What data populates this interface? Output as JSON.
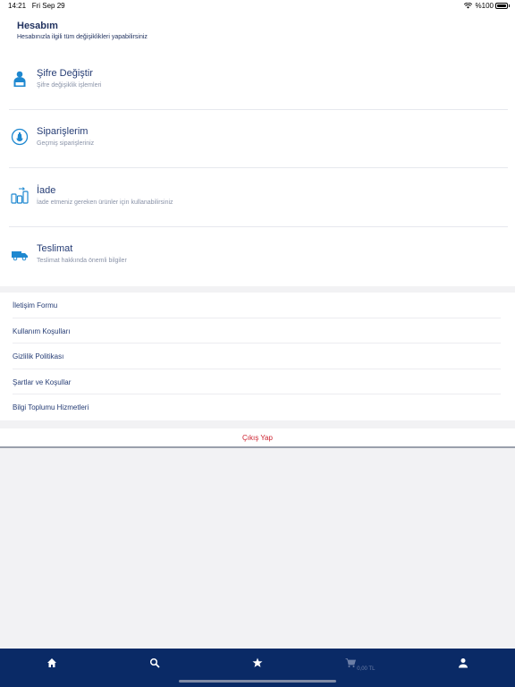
{
  "status_bar": {
    "time": "14:21",
    "date": "Fri Sep 29",
    "battery": "%100"
  },
  "header": {
    "title": "Hesabım",
    "subtitle": "Hesabınızla ilgili tüm değişiklikleri yapabilirsiniz"
  },
  "menu": [
    {
      "label": "Şifre Değiştir",
      "desc": "Şifre değişiklik işlemleri",
      "icon": "user-icon"
    },
    {
      "label": "Siparişlerim",
      "desc": "Geçmiş siparişleriniz",
      "icon": "orders-icon"
    },
    {
      "label": "İade",
      "desc": "İade etmeniz gereken ürünler için kullanabilirsiniz",
      "icon": "return-icon"
    },
    {
      "label": "Teslimat",
      "desc": "Teslimat hakkında önemli bilgiler",
      "icon": "delivery-truck-icon"
    }
  ],
  "links": [
    "İletişim Formu",
    "Kullanım Koşulları",
    "Gizlilik Politikası",
    "Şartlar ve Koşullar",
    "Bilgi Toplumu Hizmetleri"
  ],
  "logout_label": "Çıkış Yap",
  "tabbar": {
    "tabs": [
      "home-icon",
      "search-icon",
      "star-icon",
      "cart-icon",
      "profile-icon"
    ],
    "cart_total": "0,00 TL",
    "active": "profile-icon"
  },
  "colors": {
    "accent": "#0a2a66",
    "icon_blue": "#1e88d0",
    "logout_red": "#cc1f2d"
  }
}
